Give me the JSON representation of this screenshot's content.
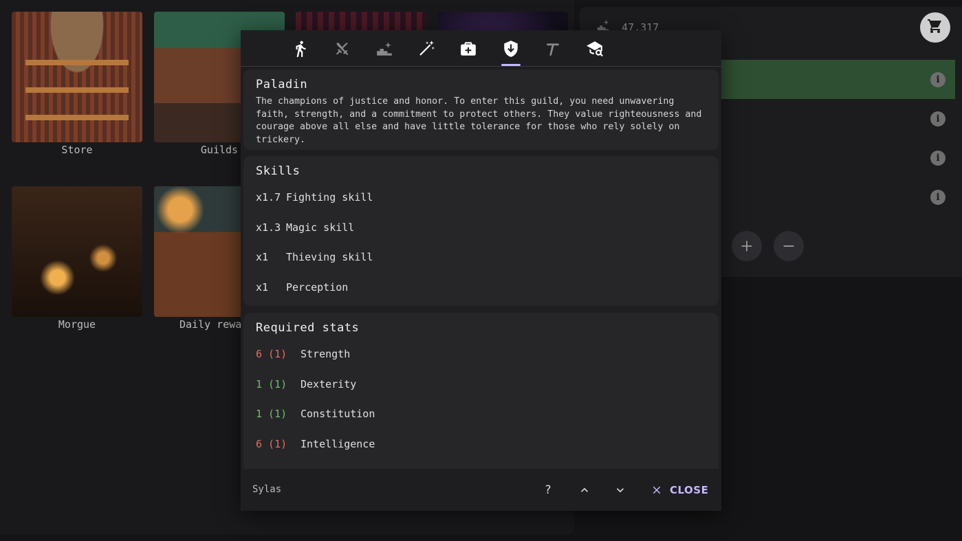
{
  "tiles": [
    {
      "label": "Store"
    },
    {
      "label": "Guilds"
    },
    {
      "label": "Morgue"
    },
    {
      "label": "Daily rewa"
    }
  ],
  "right": {
    "count": "47,317"
  },
  "dialog": {
    "tabs": [
      {
        "icon": "walking-person-icon"
      },
      {
        "icon": "crossed-swords-icon"
      },
      {
        "icon": "sparkle-stairs-icon"
      },
      {
        "icon": "magic-wand-icon"
      },
      {
        "icon": "medical-bag-icon"
      },
      {
        "icon": "shield-icon",
        "active": true
      },
      {
        "icon": "pickaxe-icon"
      },
      {
        "icon": "search-hat-icon"
      }
    ],
    "guild": {
      "name": "Paladin",
      "description": "The champions of justice and honor. To enter this guild, you need unwavering faith, strength, and a commitment to protect others. They value righteousness and courage above all else and have little tolerance for those who rely solely on trickery."
    },
    "skills": {
      "title": "Skills",
      "items": [
        {
          "mult": "x1.7",
          "name": "Fighting skill"
        },
        {
          "mult": "x1.3",
          "name": "Magic skill"
        },
        {
          "mult": "x1",
          "name": "Thieving skill"
        },
        {
          "mult": "x1",
          "name": "Perception"
        }
      ]
    },
    "required": {
      "title": "Required stats",
      "items": [
        {
          "value": "6 (1)",
          "name": "Strength",
          "color": "#e56d5b"
        },
        {
          "value": "1 (1)",
          "name": "Dexterity",
          "color": "#6fbf6a"
        },
        {
          "value": "1 (1)",
          "name": "Constitution",
          "color": "#6fbf6a"
        },
        {
          "value": "6 (1)",
          "name": "Intelligence",
          "color": "#e56d5b"
        }
      ]
    },
    "footer": {
      "name": "Sylas",
      "help": "?",
      "close": "CLOSE"
    }
  }
}
